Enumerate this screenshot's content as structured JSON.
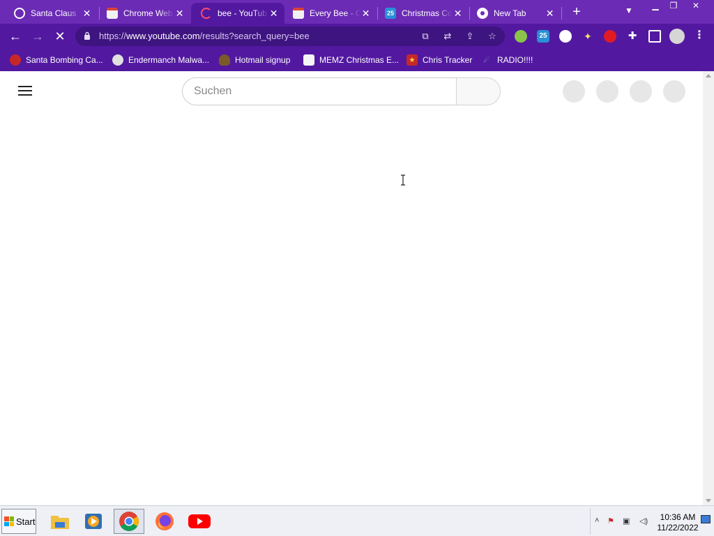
{
  "colors": {
    "tab_bg": "#6b2bb5",
    "toolbar_bg": "#5219a0",
    "omnibox_bg": "#3e1480",
    "youtube_red": "#ff0000"
  },
  "tabs": [
    {
      "title": "Santa Claus",
      "icon": "globe-icon",
      "active": false
    },
    {
      "title": "Chrome Web",
      "icon": "webstore-icon",
      "active": false
    },
    {
      "title": "bee - YouTub",
      "icon": "loading-icon",
      "active": true
    },
    {
      "title": "Every Bee - C",
      "icon": "webstore-icon",
      "active": false
    },
    {
      "title": "Christmas Co",
      "icon": "calendar-25-icon",
      "active": false
    },
    {
      "title": "New Tab",
      "icon": "chrome-icon",
      "active": false
    }
  ],
  "toolbar": {
    "url_prefix": "https://",
    "url_host": "www.youtube.com",
    "url_path": "/results?search_query=bee",
    "calendar_badge": "25"
  },
  "bookmarks": [
    {
      "label": "Santa Bombing Ca...",
      "icon": "santa-icon"
    },
    {
      "label": "Endermanch Malwa...",
      "icon": "raccoon-icon"
    },
    {
      "label": "Hotmail signup",
      "icon": "poop-icon"
    },
    {
      "label": "MEMZ Christmas E...",
      "icon": "image-icon"
    },
    {
      "label": "Chris Tracker",
      "icon": "star-icon"
    },
    {
      "label": "RADIO!!!!",
      "icon": "radio-icon"
    }
  ],
  "youtube": {
    "search_placeholder": "Suchen"
  },
  "taskbar": {
    "start_label": "Start",
    "time": "10:36 AM",
    "date": "11/22/2022"
  }
}
